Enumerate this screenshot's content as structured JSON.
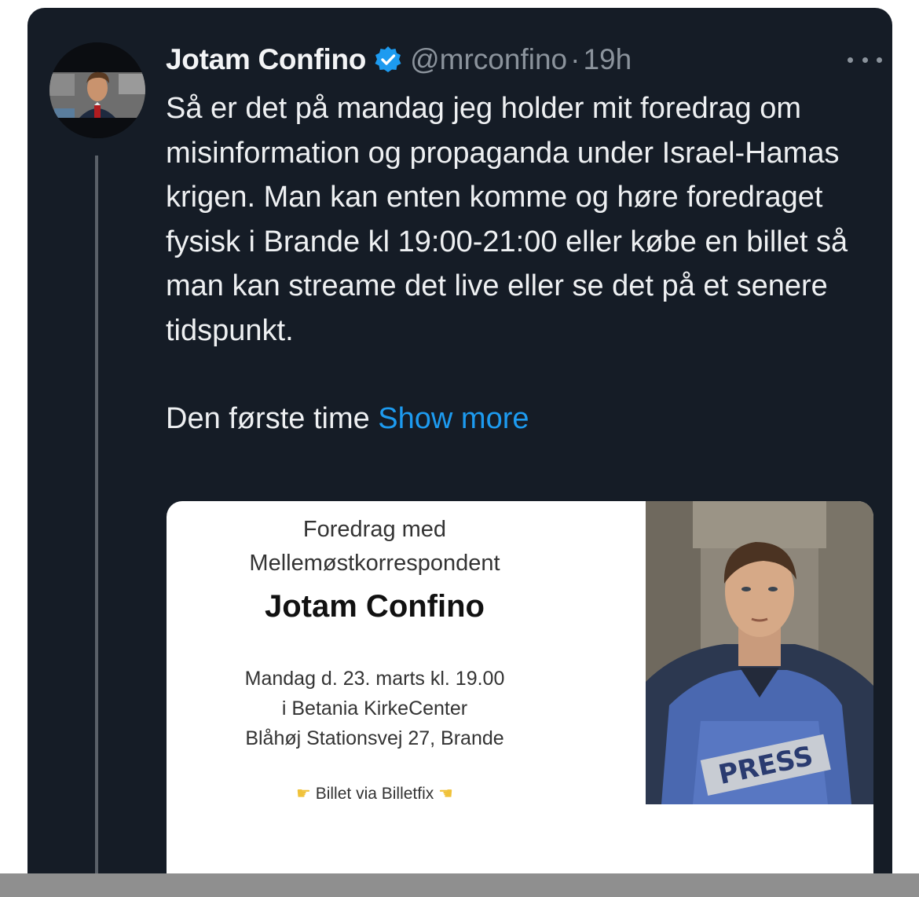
{
  "tweet": {
    "display_name": "Jotam Confino",
    "handle": "@mrconfino",
    "separator": "·",
    "timestamp": "19h",
    "paragraph_1": "Så er det på mandag jeg holder mit foredrag om misinformation og propaganda under Israel-Hamas krigen. Man kan enten komme og høre foredraget fysisk i Brande kl 19:00-21:00 eller købe en billet så man kan streame det live eller se det på et senere tidspunkt.",
    "paragraph_2": "Den første time",
    "show_more": "Show more"
  },
  "poster": {
    "line_1": "Foredrag med",
    "line_2": "Mellemøstkorrespondent",
    "name": "Jotam Confino",
    "date_line": "Mandag d. 23. marts kl. 19.00",
    "venue_line": "i Betania KirkeCenter",
    "address_line": "Blåhøj Stationsvej 27, Brande",
    "ticket_line": "Billet via Billetfix",
    "vest_text": "PRESS"
  },
  "colors": {
    "background": "#151c26",
    "text": "#eef0f2",
    "muted": "#8b939c",
    "link": "#1d9bf0",
    "verified": "#1d9bf0"
  },
  "icons": [
    "verified-badge-icon",
    "more-options-icon",
    "pointing-right-icon",
    "pointing-left-icon"
  ]
}
